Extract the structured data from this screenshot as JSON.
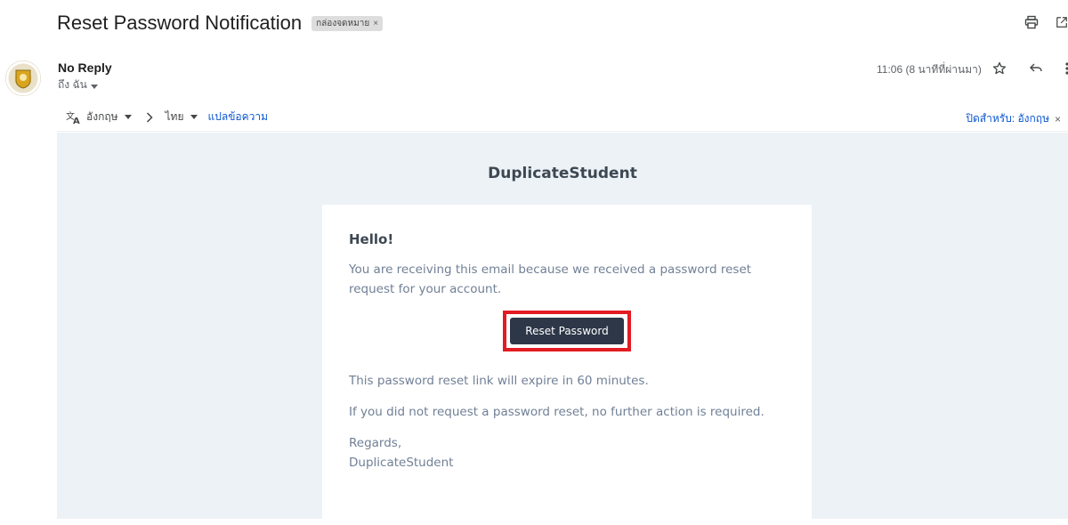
{
  "subject": {
    "title": "Reset Password Notification",
    "label_chip": "กล่องจดหมาย",
    "label_close": "×"
  },
  "sender": {
    "name": "No Reply",
    "to": "ถึง ฉัน",
    "time": "11:06 (8 นาทีที่ผ่านมา)"
  },
  "translate": {
    "from_lang": "อังกฤษ",
    "to_lang": "ไทย",
    "translate_link": "แปลข้อความ",
    "turn_off": "ปิดสำหรับ: อังกฤษ",
    "close": "×"
  },
  "email": {
    "brand": "DuplicateStudent",
    "greeting": "Hello!",
    "intro": "You are receiving this email because we received a password reset request for your account.",
    "button": "Reset Password",
    "expire_note": "This password reset link will expire in 60 minutes.",
    "no_action": "If you did not request a password reset, no further action is required.",
    "regards": "Regards,",
    "signature": "DuplicateStudent"
  },
  "colors": {
    "highlight_border": "#e31b23",
    "button_bg": "#2d3748",
    "email_bg": "#edf2f7",
    "link_blue": "#0b57d0"
  },
  "icons": [
    "print-icon",
    "open-in-new-window-icon",
    "star-icon",
    "reply-icon",
    "more-vert-icon",
    "translate-icon",
    "chevron-right-icon",
    "dropdown-arrow-icon"
  ]
}
